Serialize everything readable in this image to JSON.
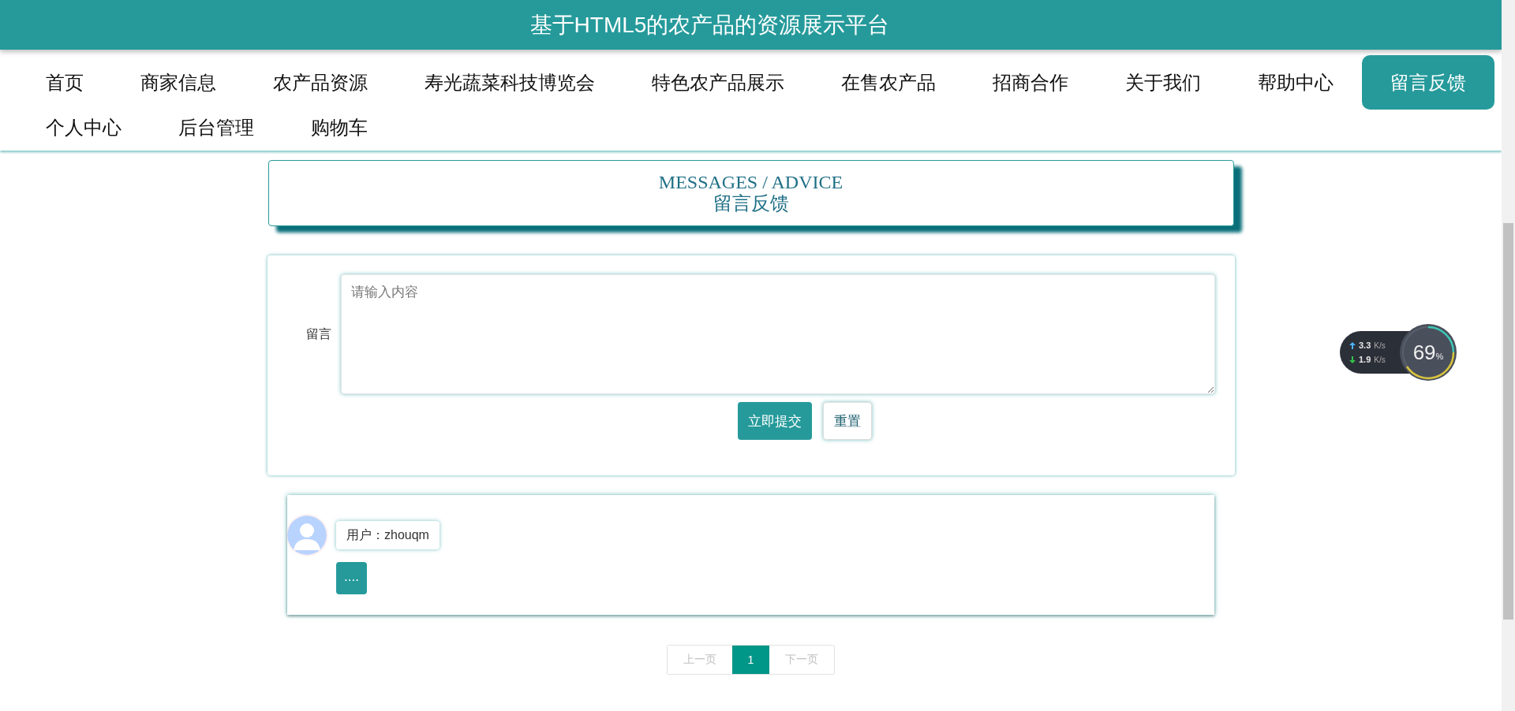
{
  "header": {
    "title": "基于HTML5的农产品的资源展示平台"
  },
  "nav": {
    "items": [
      {
        "label": "首页",
        "selected": false
      },
      {
        "label": "商家信息",
        "selected": false
      },
      {
        "label": "农产品资源",
        "selected": false
      },
      {
        "label": "寿光蔬菜科技博览会",
        "selected": false
      },
      {
        "label": "特色农产品展示",
        "selected": false
      },
      {
        "label": "在售农产品",
        "selected": false
      },
      {
        "label": "招商合作",
        "selected": false
      },
      {
        "label": "关于我们",
        "selected": false
      },
      {
        "label": "帮助中心",
        "selected": false
      },
      {
        "label": "留言反馈",
        "selected": true
      },
      {
        "label": "个人中心",
        "selected": false
      },
      {
        "label": "后台管理",
        "selected": false
      },
      {
        "label": "购物车",
        "selected": false
      }
    ]
  },
  "title_card": {
    "english": "MESSAGES / ADVICE",
    "chinese": "留言反馈"
  },
  "form": {
    "label": "留言",
    "placeholder": "请输入内容",
    "buttons": [
      {
        "label": "立即提交",
        "kind": "primary"
      },
      {
        "label": "重置",
        "kind": "plain"
      }
    ]
  },
  "messages": [
    {
      "user": "用户：zhouqm",
      "content": "...."
    }
  ],
  "pagination": {
    "prev": {
      "label": "上一页",
      "disabled": true
    },
    "pages": [
      {
        "label": "1",
        "selected": true
      }
    ],
    "next": {
      "label": "下一页",
      "disabled": true
    }
  },
  "speed_widget": {
    "upload": "3.3",
    "upload_unit": "K/s",
    "download": "1.9",
    "download_unit": "K/s",
    "percent": "69",
    "percent_unit": "%"
  }
}
